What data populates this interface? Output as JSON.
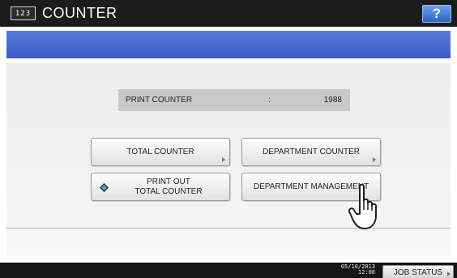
{
  "header": {
    "icon_text": "123",
    "title": "COUNTER",
    "help_label": "?"
  },
  "print_counter": {
    "label": "PRINT COUNTER",
    "separator": ":",
    "value": "1988"
  },
  "buttons": {
    "total_counter": "TOTAL COUNTER",
    "department_counter": "DEPARTMENT COUNTER",
    "print_out_line1": "PRINT OUT",
    "print_out_line2": "TOTAL COUNTER",
    "department_management": "DEPARTMENT MANAGEMENT"
  },
  "status_bar": {
    "date": "05/10/2013",
    "time": "12:08",
    "job_status_label": "JOB STATUS"
  },
  "icons": {
    "header_icon": "counter-icon",
    "print_icon": "diamond-icon",
    "pointer": "hand-pointer-icon"
  },
  "colors": {
    "title_bar": "#1c1c1c",
    "blue_band": "#3a5bc7",
    "help_button": "#2b66c9",
    "print_icon": "#3aa9c9"
  }
}
